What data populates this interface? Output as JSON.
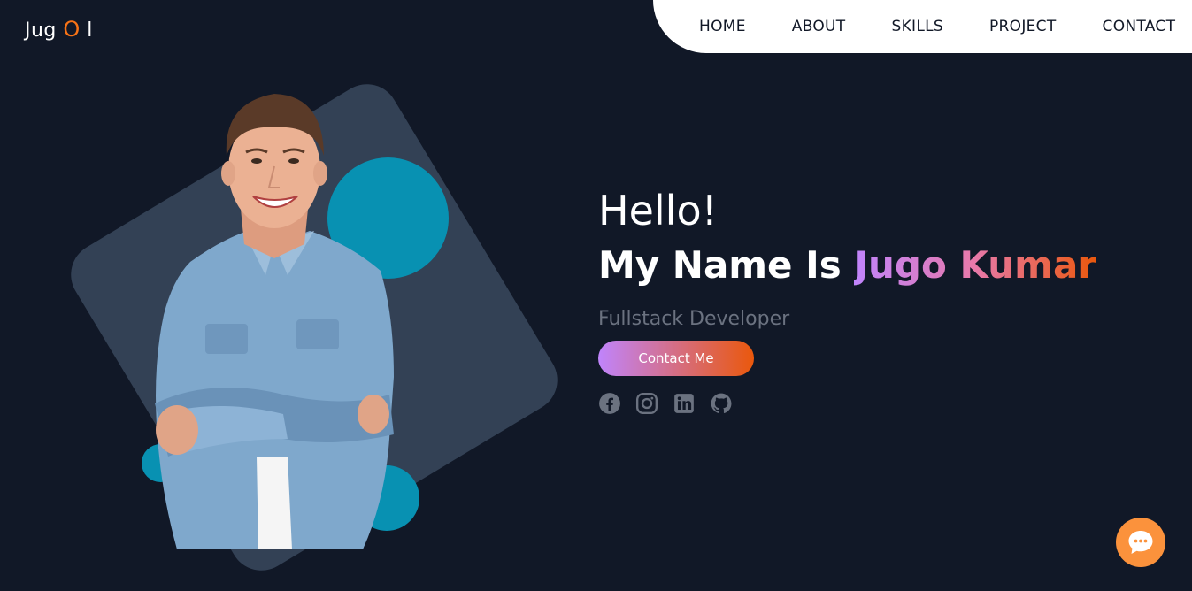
{
  "logo": {
    "part1": "Jug ",
    "accent": "O",
    "part2": " l"
  },
  "nav": {
    "items": [
      {
        "label": "HOME"
      },
      {
        "label": "ABOUT"
      },
      {
        "label": "SKILLS"
      },
      {
        "label": "PROJECT"
      },
      {
        "label": "CONTACT"
      }
    ]
  },
  "hero": {
    "greeting": "Hello!",
    "name_prefix": "My Name Is ",
    "name": "Jugo Kumar",
    "role": "Fullstack Developer",
    "cta_label": "Contact Me"
  },
  "socials": [
    {
      "icon": "facebook-icon"
    },
    {
      "icon": "instagram-icon"
    },
    {
      "icon": "linkedin-icon"
    },
    {
      "icon": "github-icon"
    }
  ],
  "colors": {
    "background": "#111827",
    "accent_orange": "#f97316",
    "tile": "#334155",
    "circle": "#0891b2",
    "gradient_start": "#c084fc",
    "gradient_end": "#ea580c",
    "chat": "#fb923c"
  },
  "chat": {
    "icon": "chat-bubble-icon"
  }
}
